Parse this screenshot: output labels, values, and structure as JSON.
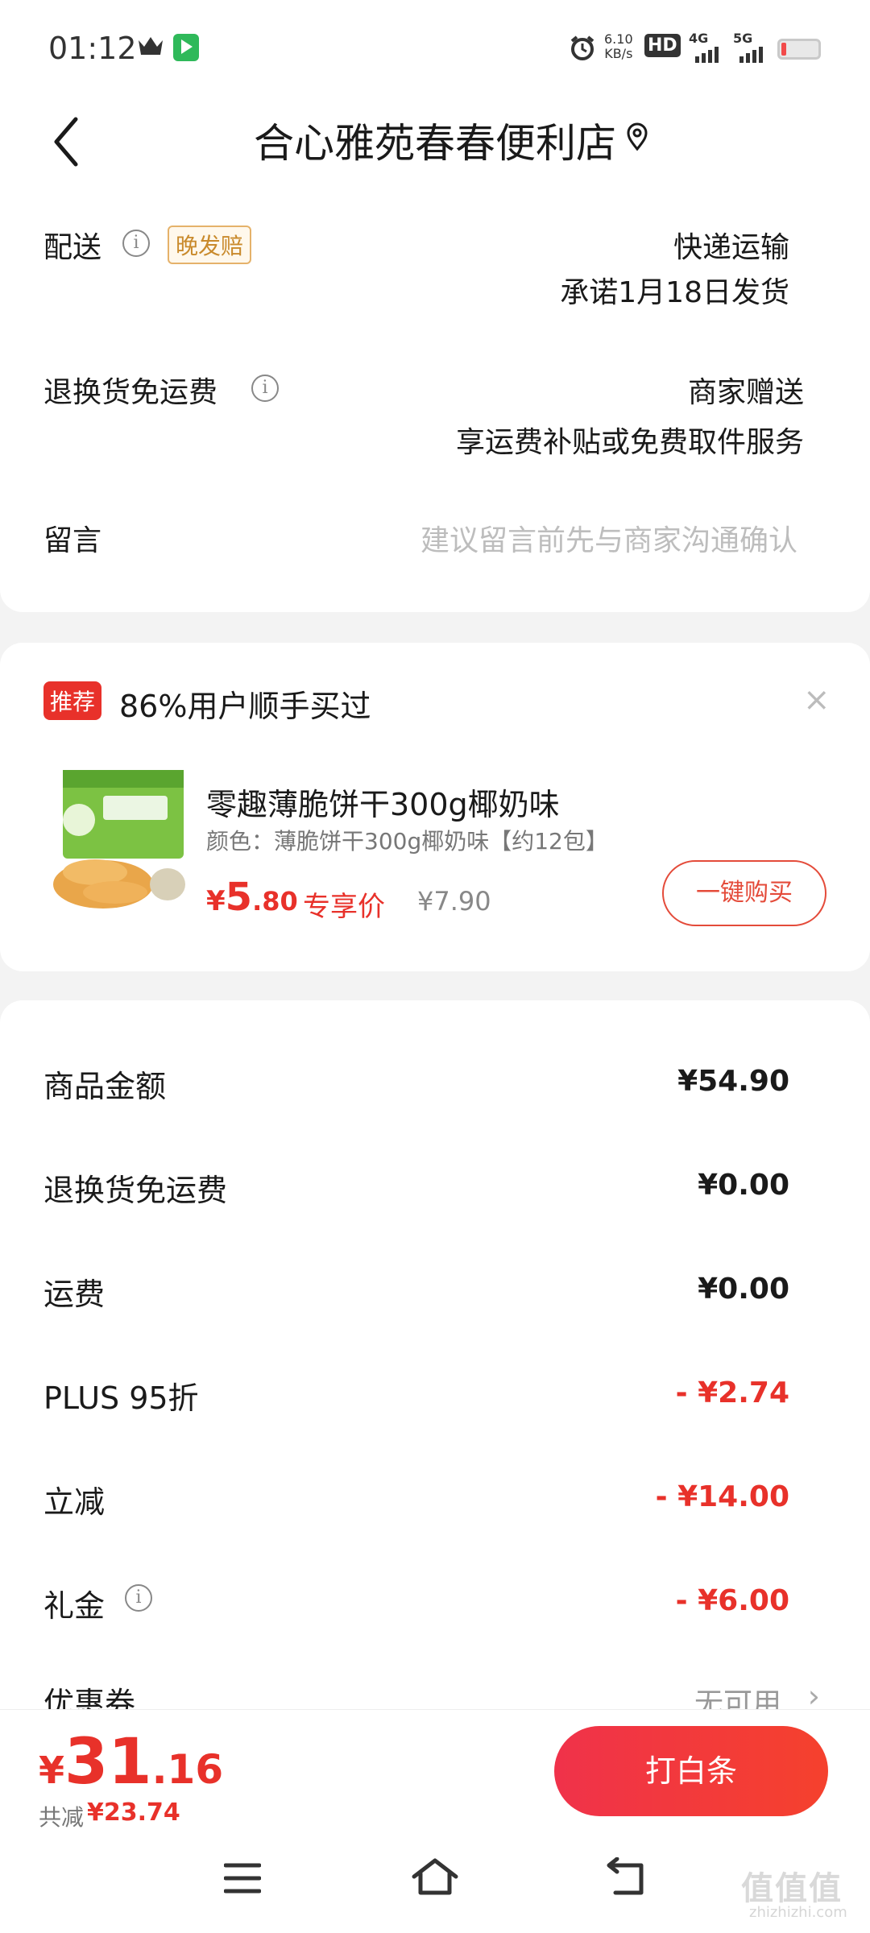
{
  "status_bar": {
    "time": "01:12",
    "net_speed_value": "6.10",
    "net_speed_unit": "KB/s",
    "hd_label": "HD",
    "signal1_label": "4G",
    "signal2_label": "5G",
    "battery_level": 0.1
  },
  "header": {
    "store_name": "合心雅苑春春便利店"
  },
  "delivery": {
    "label": "配送",
    "late_tag": "晚发赔",
    "method": "快递运输",
    "promise": "承诺1月18日发货"
  },
  "return_shipping": {
    "label": "退换货免运费",
    "value": "商家赠送",
    "description": "享运费补贴或免费取件服务"
  },
  "message": {
    "label": "留言",
    "placeholder": "建议留言前先与商家沟通确认"
  },
  "recommend": {
    "tag": "推荐",
    "title": "86%用户顺手买过",
    "product": {
      "name": "零趣薄脆饼干300g椰奶味",
      "spec": "颜色：薄脆饼干300g椰奶味【约12包】",
      "price_currency": "¥",
      "price_int": "5",
      "price_dec": ".80",
      "price_tag": "专享价",
      "original_price": "¥7.90",
      "buy_label": "一键购买"
    }
  },
  "summary": {
    "rows": [
      {
        "label": "商品金额",
        "value": "¥54.90"
      },
      {
        "label": "退换货免运费",
        "value": "¥0.00"
      },
      {
        "label": "运费",
        "value": "¥0.00"
      },
      {
        "label": "PLUS 95折",
        "value": "- ¥2.74"
      },
      {
        "label": "立减",
        "value": "- ¥14.00"
      },
      {
        "label": "礼金",
        "value": "- ¥6.00"
      }
    ],
    "coupon_label": "优惠券",
    "coupon_value": "无可用"
  },
  "bottom": {
    "total_currency": "¥",
    "total_int": "31",
    "total_dec": ".16",
    "saving_label": "共减",
    "saving_value": "¥23.74",
    "pay_label": "打白条"
  },
  "watermark": {
    "text": "值值值",
    "sub": "zhizhizhi.com"
  },
  "colors": {
    "accent_red": "#e8312a",
    "late_tag_orange": "#c98a2c"
  }
}
